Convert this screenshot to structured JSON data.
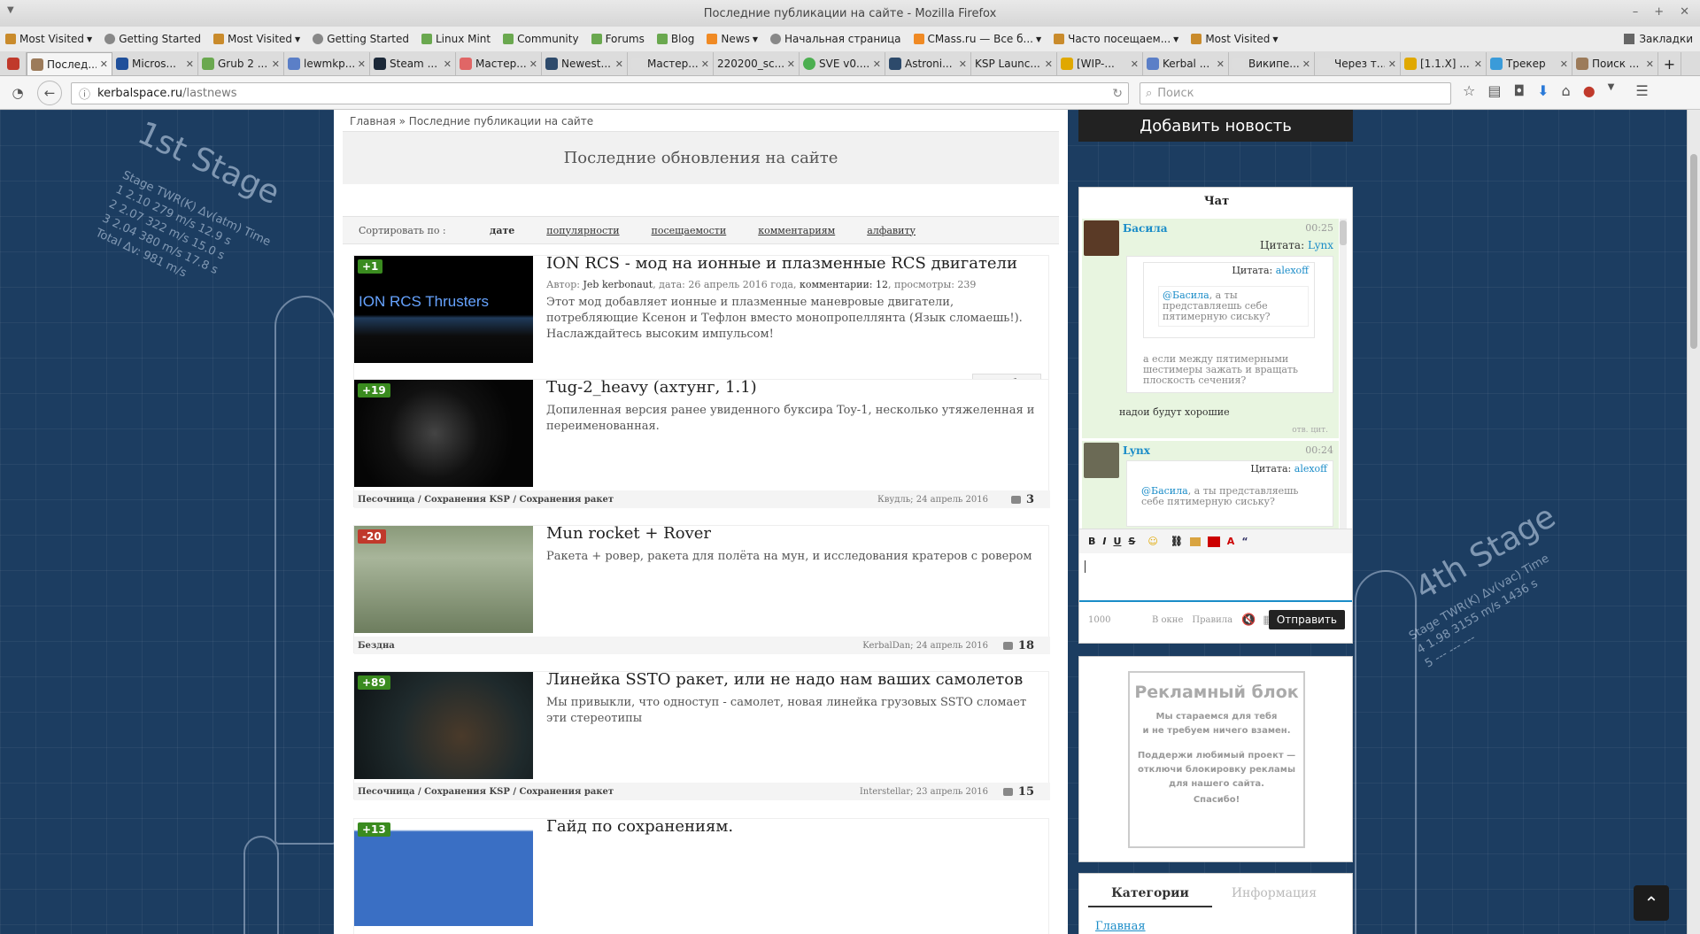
{
  "window": {
    "title": "Последние публикации на сайте - Mozilla Firefox"
  },
  "bookmarks": [
    "Most Visited",
    "Getting Started",
    "Most Visited",
    "Getting Started",
    "Linux Mint",
    "Community",
    "Forums",
    "Blog",
    "News",
    "Начальная страница",
    "CMass.ru — Все б...",
    "Часто посещаем...",
    "Most Visited"
  ],
  "bookmarks_right": "Закладки",
  "tabs": [
    "Послед...",
    "Micros...",
    "Grub 2 ...",
    "lewmkp...",
    "Steam ...",
    "Мастер...",
    "Newest...",
    "Мастер...",
    "220200_sc...",
    "SVE v0....",
    "Astroni...",
    "KSP Launc...",
    "[WIP-...",
    "Kerbal ...",
    "Википе...",
    "Через т...",
    "[1.1.X] ...",
    "Трекер",
    "Поиск ..."
  ],
  "url": {
    "host": "kerbalspace.ru",
    "path": "/lastnews"
  },
  "search": {
    "placeholder": "Поиск"
  },
  "page": {
    "breadcrumb": "Главная » Последние публикации на сайте",
    "title": "Последние обновления на сайте",
    "sort_label": "Сортировать по :",
    "sort_options": [
      "дате",
      "популярности",
      "посещаемости",
      "комментариям",
      "алфавиту"
    ]
  },
  "articles": [
    {
      "rating": "+1",
      "title": "ION RCS - мод на ионные и плазменные RCS двигатели",
      "meta_author": "Jeb kerbonaut",
      "meta_date": "26 апрель 2016 года",
      "meta_comments": "комментарии: 12",
      "meta_views": "просмотры: 239",
      "desc": "Этот мод добавляет ионные и плазменные маневровые двигатели, потребляющие Ксенон и Тефлон вместо монопропеллянта (Язык сломаешь!). Наслаждайтесь высоким импульсом!",
      "more": "Подробнее",
      "thumb_text": "ION RCS Thrusters"
    },
    {
      "rating": "+19",
      "title": "Tug-2_heavy (ахтунг, 1.1)",
      "desc": "Допиленная версия ранее увиденного буксира Toy-1, несколько утяжеленная и переименованная.",
      "category": "Песочница / Сохранения KSP / Сохранения ракет",
      "author_date": "Квудль; 24 апрель 2016",
      "comments": "3"
    },
    {
      "rating": "-20",
      "title": "Mun rocket + Rover",
      "desc": "Ракета + ровер, ракета для полёта на мун, и исследования кратеров с ровером",
      "category": "Бездна",
      "author_date": "KerbalDan; 24 апрель 2016",
      "comments": "18"
    },
    {
      "rating": "+89",
      "title": "Линейка SSTO ракет, или не надо нам ваших самолетов",
      "desc": "Мы привыкли, что одноступ - самолет, новая линейка грузовых SSTO сломает эти стереотипы",
      "category": "Песочница / Сохранения KSP / Сохранения ракет",
      "author_date": "Interstellar; 23 апрель 2016",
      "comments": "15"
    },
    {
      "rating": "+13",
      "title": "Гайд по сохранениям."
    }
  ],
  "sidebar": {
    "add_news": "Добавить новость",
    "chat_title": "Чат",
    "messages": [
      {
        "nick": "Басила",
        "time": "00:25",
        "quote1_label": "Цитата:",
        "quote1_author": "Lynx",
        "quote2_label": "Цитата:",
        "quote2_author": "alexoff",
        "inner_mention": "@Басила",
        "inner_text": ", а ты представляешь себе пятимерную сиську?",
        "quote_text": "а если между пятимерными шестимеры зажать и вращать плоскость сечения?",
        "text": "надои будут хорошие",
        "actions": "отв. цит."
      },
      {
        "nick": "Lynx",
        "time": "00:24",
        "quote_label": "Цитата:",
        "quote_author": "alexoff",
        "mention": "@Басила",
        "quote_text": ", а ты представляешь себе пятимерную сиську?"
      }
    ],
    "editor_buttons": [
      "B",
      "I",
      "U",
      "S"
    ],
    "char_count": "1000",
    "in_window": "В окне",
    "rules": "Правила",
    "send": "Отправить",
    "ad_title": "Рекламный блок",
    "ad_line1": "Мы стараемся для тебя",
    "ad_line2": "и не требуем ничего взамен.",
    "ad_line3": "Поддержи любимый проект —",
    "ad_line4": "отключи блокировку рекламы",
    "ad_line5": "для нашего сайта.",
    "ad_line6": "Спасибо!",
    "cat_tab1": "Категории",
    "cat_tab2": "Информация",
    "cat_link": "Главная"
  },
  "deco": {
    "stage1": "1st Stage",
    "stage1_table": [
      "Stage  TWR(K)   Δv(atm)   Time",
      "1      2.10    279 m/s   12.9 s",
      "2      2.07    322 m/s   15.0 s",
      "3      2.04    380 m/s   17.8 s",
      "Total Δv: 981 m/s"
    ],
    "stage4": "4th Stage",
    "stage4_table": [
      "Stage  TWR(K)  Δv(vac)   Time",
      "4      1.98   3155 m/s  1436 s",
      "5       ---      ---     ---"
    ]
  }
}
